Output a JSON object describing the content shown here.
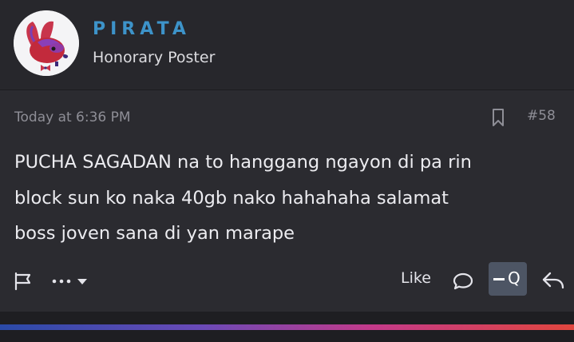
{
  "user": {
    "name": "PIRATA",
    "title": "Honorary Poster",
    "name_color": "#3d93c9"
  },
  "post": {
    "timestamp": "Today at 6:36 PM",
    "number": "#58",
    "message_lines": [
      "PUCHA SAGADAN na to hanggang ngayon di pa rin",
      "block sun ko naka 40gb nako hahahaha salamat",
      "boss joven sana di yan marape"
    ]
  },
  "actions": {
    "report_icon": "flag-icon",
    "more_icon": "more-menu-icon",
    "like_label": "Like",
    "comment_icon": "speech-bubble-icon",
    "quote_icon": "quote-icon",
    "quote_glyph": "Q",
    "reply_icon": "reply-arrow-icon"
  },
  "colors": {
    "background": "#252529",
    "post_background": "#2b2b30",
    "quote_active": "#4d5564",
    "muted_text": "#8e8e96"
  }
}
